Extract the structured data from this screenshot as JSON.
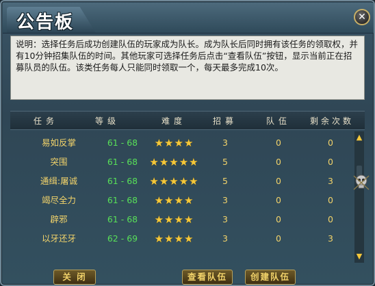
{
  "window": {
    "title": "公告板",
    "close_glyph": "✕"
  },
  "notice": {
    "text": "说明：选择任务后成功创建队伍的玩家成为队长。成为队长后同时拥有该任务的领取权，并有10分钟招集队伍的时间。其他玩家可选择任务后点击“查看队伍”按钮，显示当前正在招募队员的队伍。该类任务每人只能同时领取一个，每天最多完成10次。"
  },
  "table": {
    "headers": [
      "任务",
      "等级",
      "难度",
      "招募",
      "队伍",
      "剩余次数"
    ],
    "rows": [
      {
        "name": "易如反掌",
        "level": "61 - 68",
        "stars": 4,
        "recruit": "3",
        "team": "0",
        "remaining": "0"
      },
      {
        "name": "突围",
        "level": "61 - 68",
        "stars": 5,
        "recruit": "5",
        "team": "0",
        "remaining": "0"
      },
      {
        "name": "通缉:屠诚",
        "level": "61 - 68",
        "stars": 5,
        "recruit": "5",
        "team": "0",
        "remaining": "3"
      },
      {
        "name": "竭尽全力",
        "level": "61 - 68",
        "stars": 4,
        "recruit": "3",
        "team": "0",
        "remaining": "0"
      },
      {
        "name": "辟邪",
        "level": "61 - 68",
        "stars": 4,
        "recruit": "3",
        "team": "0",
        "remaining": "0"
      },
      {
        "name": "以牙还牙",
        "level": "62 - 69",
        "stars": 4,
        "recruit": "3",
        "team": "0",
        "remaining": "3"
      }
    ]
  },
  "scrollbar": {
    "up_glyph": "▲",
    "down_glyph": "▼"
  },
  "buttons": {
    "close": "关 闭",
    "view_team": "查看队伍",
    "create_team": "创建队伍"
  },
  "colors": {
    "accent_gold": "#f2d36a",
    "level_green": "#58e058",
    "star": "#f5c83a"
  }
}
